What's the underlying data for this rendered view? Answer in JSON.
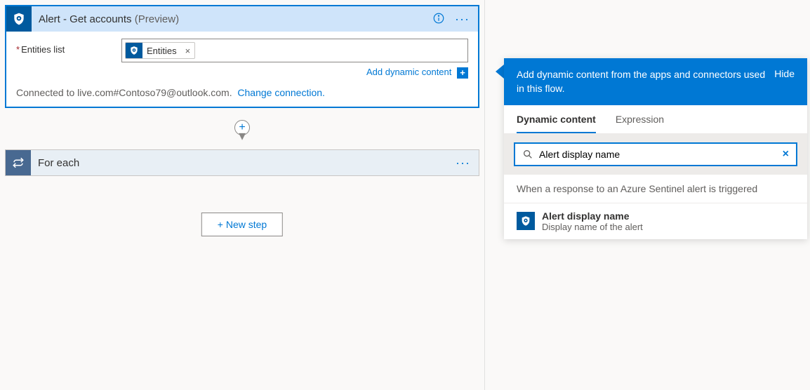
{
  "alertCard": {
    "title": "Alert - Get accounts",
    "preview": "(Preview)",
    "fieldLabel": "Entities list",
    "tokenLabel": "Entities",
    "addDynamic": "Add dynamic content",
    "connectedText": "Connected to live.com#Contoso79@outlook.com.",
    "changeConnection": "Change connection."
  },
  "foreach": {
    "title": "For each"
  },
  "newStep": "+ New step",
  "dcPanel": {
    "headerText": "Add dynamic content from the apps and connectors used in this flow.",
    "hide": "Hide",
    "tabs": {
      "dynamic": "Dynamic content",
      "expression": "Expression"
    },
    "searchValue": "Alert display name",
    "triggerLabel": "When a response to an Azure Sentinel alert is triggered",
    "item": {
      "title": "Alert display name",
      "subtitle": "Display name of the alert"
    }
  }
}
